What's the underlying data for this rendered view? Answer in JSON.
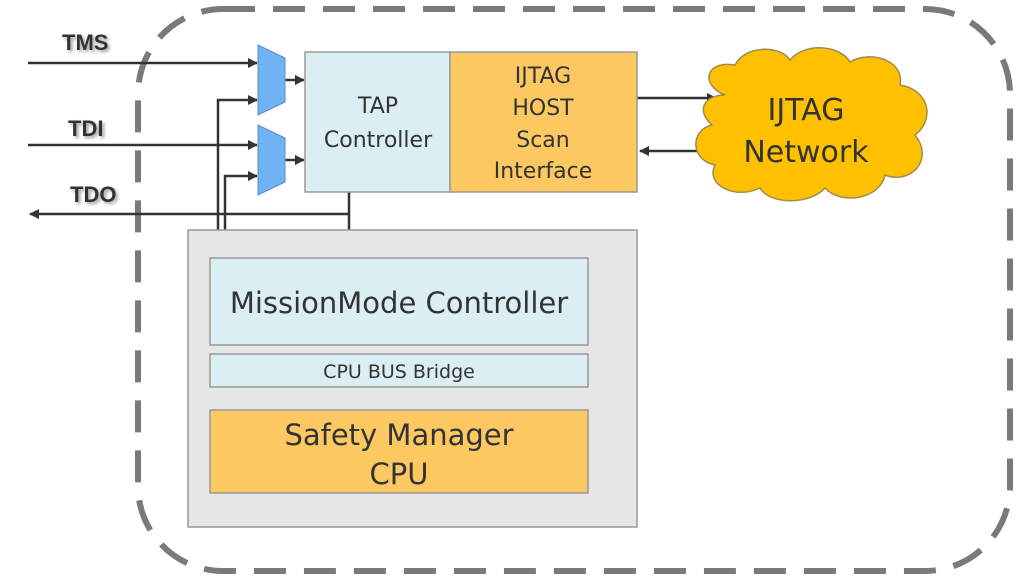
{
  "signals": {
    "tms": "TMS",
    "tdi": "TDI",
    "tdo": "TDO"
  },
  "tap_controller": {
    "line1": "TAP",
    "line2": "Controller"
  },
  "ijtag_host": {
    "line1": "IJTAG",
    "line2": "HOST",
    "line3": "Scan",
    "line4": "Interface"
  },
  "ijtag_network": {
    "line1": "IJTAG",
    "line2": "Network"
  },
  "mission_mode": "MissionMode Controller",
  "cpu_bus_bridge": "CPU BUS Bridge",
  "safety_manager": {
    "line1": "Safety Manager",
    "line2": "CPU"
  },
  "colors": {
    "light_blue": "#dbeef4",
    "orange": "#fcc862",
    "cloud": "#ffc000",
    "mux": "#6fb3f5",
    "gray_box": "#e6e6e6"
  }
}
